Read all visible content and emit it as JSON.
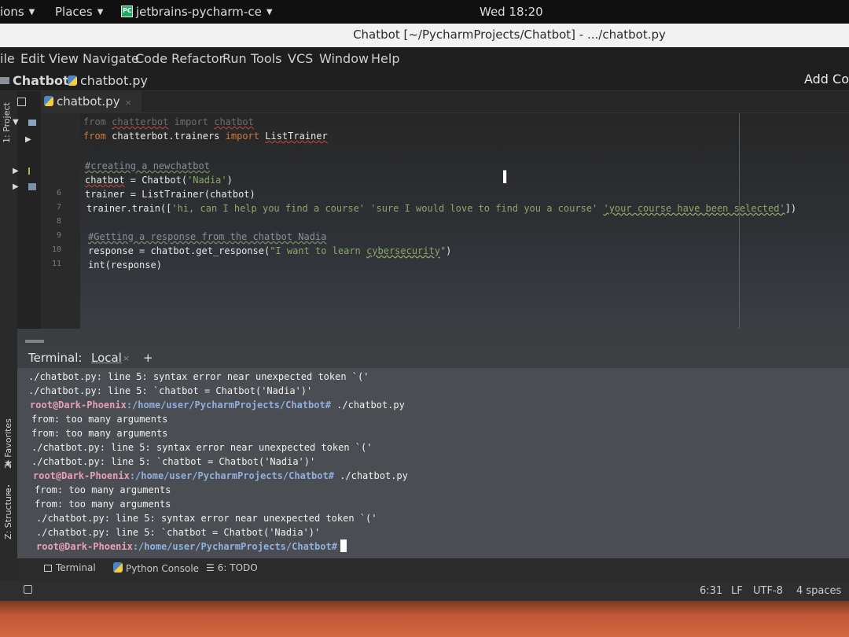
{
  "topbar": {
    "activities": "ions",
    "places": "Places",
    "app_name": "jetbrains-pycharm-ce",
    "clock": "Wed 18:20"
  },
  "window": {
    "title": "Chatbot [~/PycharmProjects/Chatbot] - .../chatbot.py"
  },
  "menu": [
    "ile",
    "Edit",
    "View",
    "Navigate",
    "Code",
    "Refactor",
    "Run",
    "Tools",
    "VCS",
    "Window",
    "Help"
  ],
  "navbar": {
    "project": "Chatbot",
    "file": "chatbot.py",
    "add_config": "Add Co"
  },
  "side_tabs": {
    "project": "1: Project",
    "favorites": "2: Favorites",
    "structure": "Z: Structure"
  },
  "editor": {
    "tab_label": "chatbot.py",
    "tab_close": "×",
    "line_numbers": [
      "",
      "",
      "",
      "",
      "6",
      "7",
      "8",
      "9",
      "10",
      "11"
    ],
    "lines": {
      "l1_kw": "from",
      "l1_mod": "chatterbot",
      "l1_kw2": "import",
      "l1_name": "chatbot",
      "l2_kw": "from",
      "l2_mod": "chatterbot.trainers",
      "l2_kw2": "import",
      "l2_name": "ListTrainer",
      "l3_comment": "#creating a newchatbot",
      "l4_var": "chatbot",
      "l4_eq": " = Chatbot(",
      "l4_str": "'Nadia'",
      "l4_end": ")",
      "l5": "trainer = ListTrainer(chatbot)",
      "l6_a": "trainer.train([",
      "l6_s1": "'hi, can I help you find a course'",
      "l6_s2": "'sure I would love to find you a course'",
      "l6_s3": "'your course have been selected'",
      "l6_end": "])",
      "l7_comment": "#Getting a response from the chatbot Nadia",
      "l8_a": "response = chatbot.get_response(",
      "l8_str": "\"I want to learn ",
      "l8_strul": "cybersecurity",
      "l8_strend": "\"",
      "l8_end": ")",
      "l9": "int(response)"
    }
  },
  "terminal": {
    "title": "Terminal:",
    "tab": "Local",
    "tab_close": "×",
    "add": "+",
    "prompt_user": "root@Dark-Phoenix",
    "prompt_path": ":/home/user/PycharmProjects/Chatbot#",
    "lines": [
      "./chatbot.py: line 5: syntax error near unexpected token `('",
      "./chatbot.py: line 5: `chatbot = Chatbot('Nadia')'",
      "",
      "from: too many arguments",
      "from: too many arguments",
      "./chatbot.py: line 5: syntax error near unexpected token `('",
      "./chatbot.py: line 5: `chatbot = Chatbot('Nadia')'",
      "",
      "from: too many arguments",
      "from: too many arguments",
      "./chatbot.py: line 5: syntax error near unexpected token `('",
      "./chatbot.py: line 5: `chatbot = Chatbot('Nadia')'",
      ""
    ],
    "command": " ./chatbot.py"
  },
  "bottom_tabs": {
    "terminal": "Terminal",
    "python_console": "Python Console",
    "todo": "6: TODO"
  },
  "status": {
    "position": "6:31",
    "line_sep": "LF",
    "encoding": "UTF-8",
    "indent": "4 spaces"
  }
}
